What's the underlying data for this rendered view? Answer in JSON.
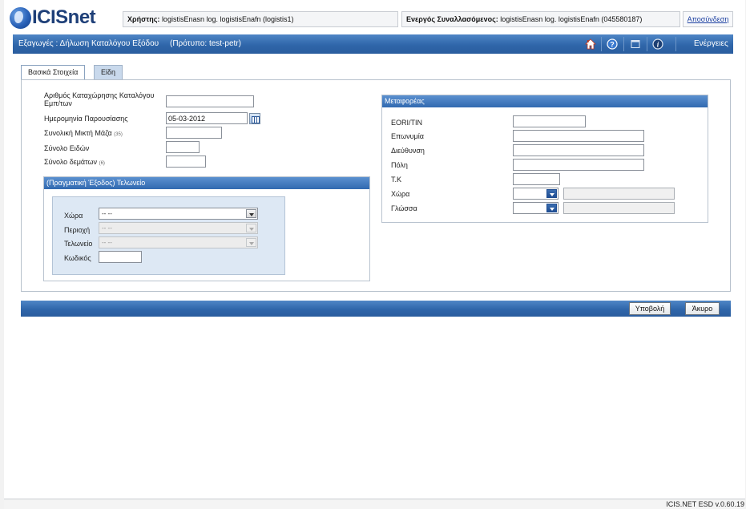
{
  "header": {
    "logo_text": "ICISnet",
    "user_label": "Χρήστης:",
    "user_value": "logistisEnasn log. logistisEnafn (logistis1)",
    "trader_label": "Ενεργός Συναλλασόμενος:",
    "trader_value": "logistisEnasn log. logistisEnafn (045580187)",
    "logout": "Αποσύνδεση"
  },
  "titlebar": {
    "title": "Εξαγωγές : Δήλωση Καταλόγου Εξόδου     (Πρότυπο: test-petr)",
    "actions": "Ενέργειες",
    "icons": [
      "home-icon",
      "help-icon",
      "window-icon",
      "info-icon"
    ]
  },
  "tabs": [
    {
      "label": "Βασικά Στοιχεία",
      "active": true
    },
    {
      "label": "Είδη",
      "active": false
    }
  ],
  "basic": {
    "reg_number_label": "Αριθμός Καταχώρησης Καταλόγου Εμπ/των",
    "reg_number_value": "",
    "presentation_date_label": "Ημερομηνία Παρουσίασης",
    "presentation_date_value": "05-03-2012",
    "gross_mass_label": "Συνολική Μικτή Μάζα",
    "gross_mass_hint": "(35)",
    "gross_mass_value": "",
    "total_items_label": "Σύνολο Ειδών",
    "total_items_value": "",
    "total_packages_label": "Σύνολο δεμάτων",
    "total_packages_hint": "(6)",
    "total_packages_value": ""
  },
  "customs": {
    "header": "(Πραγματική Έξοδος) Τελωνείο",
    "country_label": "Χώρα",
    "country_value": "-- --",
    "region_label": "Περιοχή",
    "region_value": "-- --",
    "office_label": "Τελωνείο",
    "office_value": "-- --",
    "code_label": "Κωδικός",
    "code_value": ""
  },
  "carrier": {
    "header": "Μεταφορέας",
    "eori_label": "EORI/TIN",
    "name_label": "Επωνυμία",
    "address_label": "Διεύθυνση",
    "city_label": "Πόλη",
    "postcode_label": "Τ.Κ",
    "country_label": "Χώρα",
    "language_label": "Γλώσσα"
  },
  "actions": {
    "submit": "Υποβολή",
    "cancel": "Άκυρο"
  },
  "footer": {
    "version": "ICIS.NET ESD v.0.60.19"
  },
  "colors": {
    "bar_blue": "#2f66aa",
    "link_blue": "#1a3ea0"
  }
}
